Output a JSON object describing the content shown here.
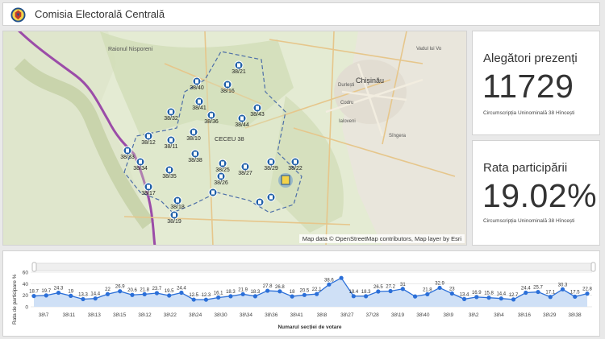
{
  "header": {
    "title": "Comisia Electorală Centrală",
    "logo_icon": "cec-coat-of-arms-icon"
  },
  "map": {
    "attribution": "Map data © OpenStreetMap contributors, Map layer by Esri",
    "place_labels": [
      "Raionul Nisporeni",
      "Chișinău",
      "Durlești",
      "Codru",
      "Ialoveni",
      "Sîngera",
      "Vadul lui Vo",
      "CECEU 38"
    ],
    "stations": [
      "38/21",
      "38/40",
      "38/16",
      "38/41",
      "38/32",
      "38/36",
      "38/43",
      "38/44",
      "38/10",
      "38/12",
      "38/11",
      "38/33",
      "38/34",
      "38/38",
      "38/35",
      "38/25",
      "38/27",
      "38/29",
      "38/22",
      "38/17",
      "38/18",
      "38/19",
      "38/26"
    ]
  },
  "stats": {
    "present": {
      "label": "Alegători prezenți",
      "value": "11729",
      "sub": "Circumscripția Uninominală 38 Hîncești"
    },
    "rate": {
      "label": "Rata participării",
      "value": "19.02%",
      "sub": "Circumscripția Uninominală 38 Hîncești"
    }
  },
  "chart_data": {
    "type": "line",
    "ylabel": "Rata de participare %",
    "xlabel": "Numarul secției de votare",
    "ylim": [
      0,
      60
    ],
    "y_ticks": [
      0,
      20,
      40,
      60
    ],
    "x_tick_labels": [
      "38\\7",
      "38\\11",
      "38\\13",
      "38\\15",
      "38\\12",
      "38\\22",
      "38\\24",
      "38\\30",
      "38\\34",
      "38\\36",
      "38\\41",
      "38\\8",
      "38\\27",
      "37\\28",
      "38\\19",
      "38\\40",
      "38\\9",
      "38\\2",
      "38\\4",
      "38\\16",
      "38\\29",
      "38\\38"
    ],
    "values": [
      18.7,
      19.7,
      24.3,
      19,
      13.3,
      14.4,
      22,
      26.9,
      20.6,
      21.8,
      23.7,
      19.5,
      24.4,
      12.5,
      12.3,
      16.1,
      18.3,
      21.9,
      18.3,
      27.8,
      26.8,
      18,
      20.5,
      22.1,
      38.6,
      50,
      18.4,
      18.3,
      26.5,
      27.2,
      31,
      18,
      21.8,
      32.9,
      23,
      13.4,
      16.9,
      15.8,
      14.4,
      12.7,
      24.4,
      25.7,
      17.1,
      30.3,
      17.5,
      22.8
    ],
    "data_labels": [
      "18.7",
      "19.7",
      "24.3",
      "19",
      "13.3",
      "14.4",
      "22",
      "26.9",
      "20.6",
      "21.8",
      "23.7",
      "19.5",
      "24.4",
      "12.5",
      "12.3",
      "16.1",
      "18.3",
      "21.9",
      "18.3",
      "27.8",
      "26.8",
      "18",
      "20.5",
      "22.1",
      "38.6",
      "",
      "18.4",
      "18.3",
      "26.5",
      "27.2",
      "31",
      "",
      "21.8",
      "32.9",
      "23",
      "13.4",
      "16.9",
      "15.8",
      "14.4",
      "12.7",
      "24.4",
      "25.7",
      "17.1",
      "30.3",
      "17.5",
      "22.8"
    ],
    "color": "#2b6fd8",
    "fill": "#cfe0f6"
  }
}
